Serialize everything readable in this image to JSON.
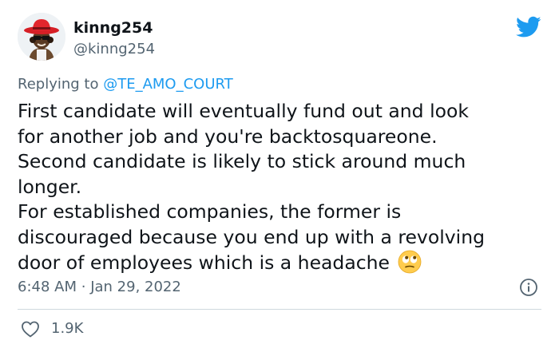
{
  "user": {
    "display_name": "kinng254",
    "handle": "@kinng254",
    "avatar_icon": "avatar-red-hat-icon"
  },
  "brand": {
    "logo_icon": "twitter-bird-icon",
    "color": "#1d9bf0"
  },
  "reply": {
    "prefix": "Replying to",
    "mention": "@TE_AMO_COURT"
  },
  "tweet": {
    "lines": [
      "First candidate will eventually fund out and look",
      "for another job and you're backtosquareone.",
      "Second candidate is likely to stick around much",
      "longer.",
      "For established companies, the former is",
      "discouraged because you end up with a revolving",
      "door of employees which is a headache"
    ],
    "trailing_emoji_icon": "face-with-rolling-eyes-icon"
  },
  "meta": {
    "time": "6:48 AM",
    "separator": "·",
    "date": "Jan 29, 2022"
  },
  "actions": {
    "like_count": "1.9K",
    "like_icon": "heart-outline-icon"
  },
  "colors": {
    "text": "#0f1419",
    "secondary": "#536471",
    "accent": "#1d9bf0",
    "divider": "#cfd9de"
  }
}
